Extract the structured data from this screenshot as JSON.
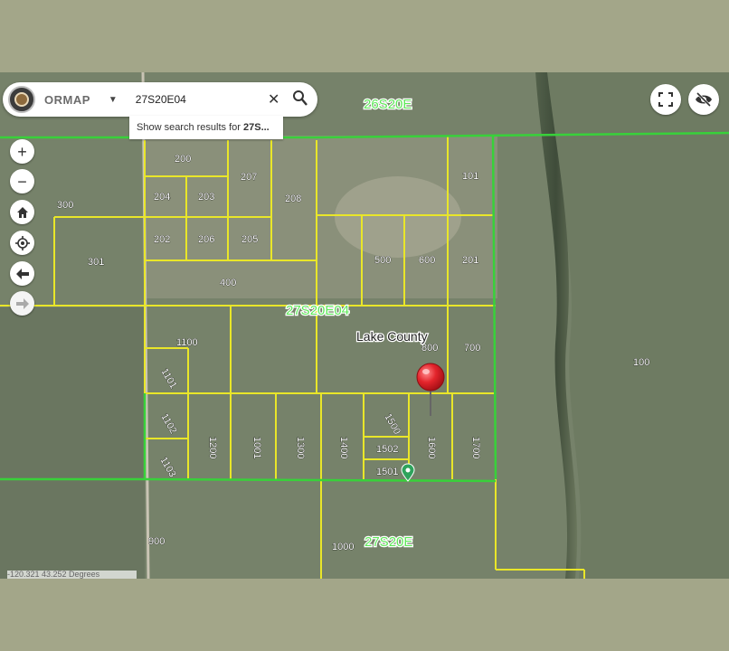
{
  "brand": "ORMAP",
  "search": {
    "value": "27S20E04",
    "suggestion_prefix": "Show search results for ",
    "suggestion_bold": "27S..."
  },
  "township_labels": [
    "26S20E",
    "27S20E04",
    "27S20E"
  ],
  "county_label": "Lake County",
  "parcels": [
    "200",
    "204",
    "203",
    "207",
    "208",
    "101",
    "300",
    "202",
    "206",
    "205",
    "301",
    "400",
    "500",
    "600",
    "201",
    "1100",
    "800",
    "700",
    "100",
    "1101",
    "1102",
    "1200",
    "1001",
    "1300",
    "1400",
    "1500",
    "1600",
    "1700",
    "1502",
    "1103",
    "1501",
    "900",
    "1000"
  ],
  "coordinate_readout": "-120.321 43.252 Degrees",
  "icons": {
    "logo": "ormap-logo-icon",
    "dropdown": "caret-down-icon",
    "clear": "close-icon",
    "search": "search-icon",
    "zoom_in": "plus-icon",
    "zoom_out": "minus-icon",
    "home": "home-icon",
    "locate": "crosshair-icon",
    "back": "arrow-left-icon",
    "forward": "arrow-right-icon",
    "fullscreen": "fullscreen-icon",
    "visibility": "eye-off-icon",
    "pin": "map-pin-icon",
    "marker": "location-marker-icon"
  },
  "colors": {
    "parcel_line": "#e9e629",
    "township_line": "#38d13a",
    "pin": "#e3242b",
    "marker": "#2fa35c"
  }
}
